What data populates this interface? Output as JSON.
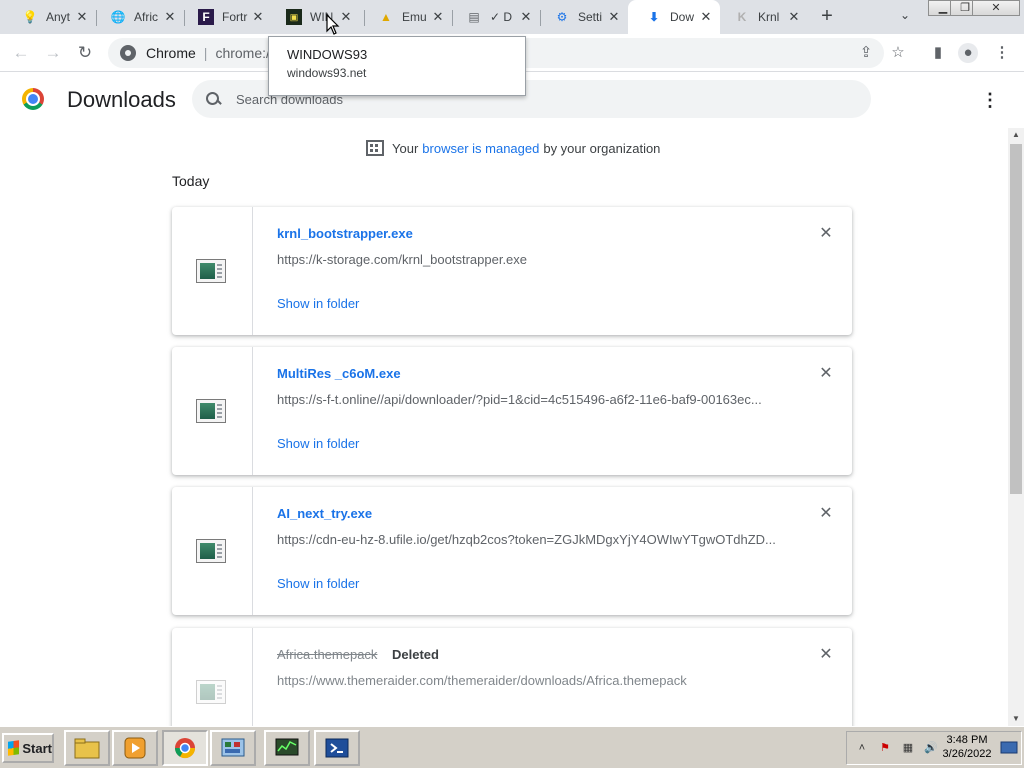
{
  "tabs": [
    {
      "label": "Anyt",
      "icon": "lightbulb-icon"
    },
    {
      "label": "Afric",
      "icon": "globe-icon"
    },
    {
      "label": "Fortr",
      "icon": "fortress-icon"
    },
    {
      "label": "WIN",
      "icon": "windows93-icon"
    },
    {
      "label": "Emu",
      "icon": "emu-icon"
    },
    {
      "label": "✓ D",
      "icon": "doc-icon"
    },
    {
      "label": "Setti",
      "icon": "gear-icon"
    },
    {
      "label": "Dow",
      "icon": "download-icon"
    },
    {
      "label": "Krnl",
      "icon": "krnl-icon"
    }
  ],
  "tooltip": {
    "title": "WINDOWS93",
    "url": "windows93.net"
  },
  "omnibox": {
    "site": "Chrome",
    "url": "chrome://"
  },
  "downloads": {
    "title": "Downloads",
    "search_placeholder": "Search downloads",
    "managed": {
      "prefix": "Your",
      "link": "browser is managed",
      "suffix": "by your organization"
    },
    "section": "Today",
    "items": [
      {
        "name": "krnl_bootstrapper.exe",
        "url": "https://k-storage.com/krnl_bootstrapper.exe",
        "action": "Show in folder",
        "status": ""
      },
      {
        "name": "MultiRes _c6oM.exe",
        "url": "https://s-f-t.online//api/downloader/?pid=1&cid=4c515496-a6f2-11e6-baf9-00163ec...",
        "action": "Show in folder",
        "status": ""
      },
      {
        "name": "AI_next_try.exe",
        "url": "https://cdn-eu-hz-8.ufile.io/get/hzqb2cos?token=ZGJkMDgxYjY4OWIwYTgwOTdhZD...",
        "action": "Show in folder",
        "status": ""
      },
      {
        "name": "Africa.themepack",
        "url": "https://www.themeraider.com/themeraider/downloads/Africa.themepack",
        "action": "",
        "status": "Deleted"
      }
    ]
  },
  "taskbar": {
    "start_label": "Start",
    "clock_time": "3:48 PM",
    "clock_date": "3/26/2022"
  }
}
